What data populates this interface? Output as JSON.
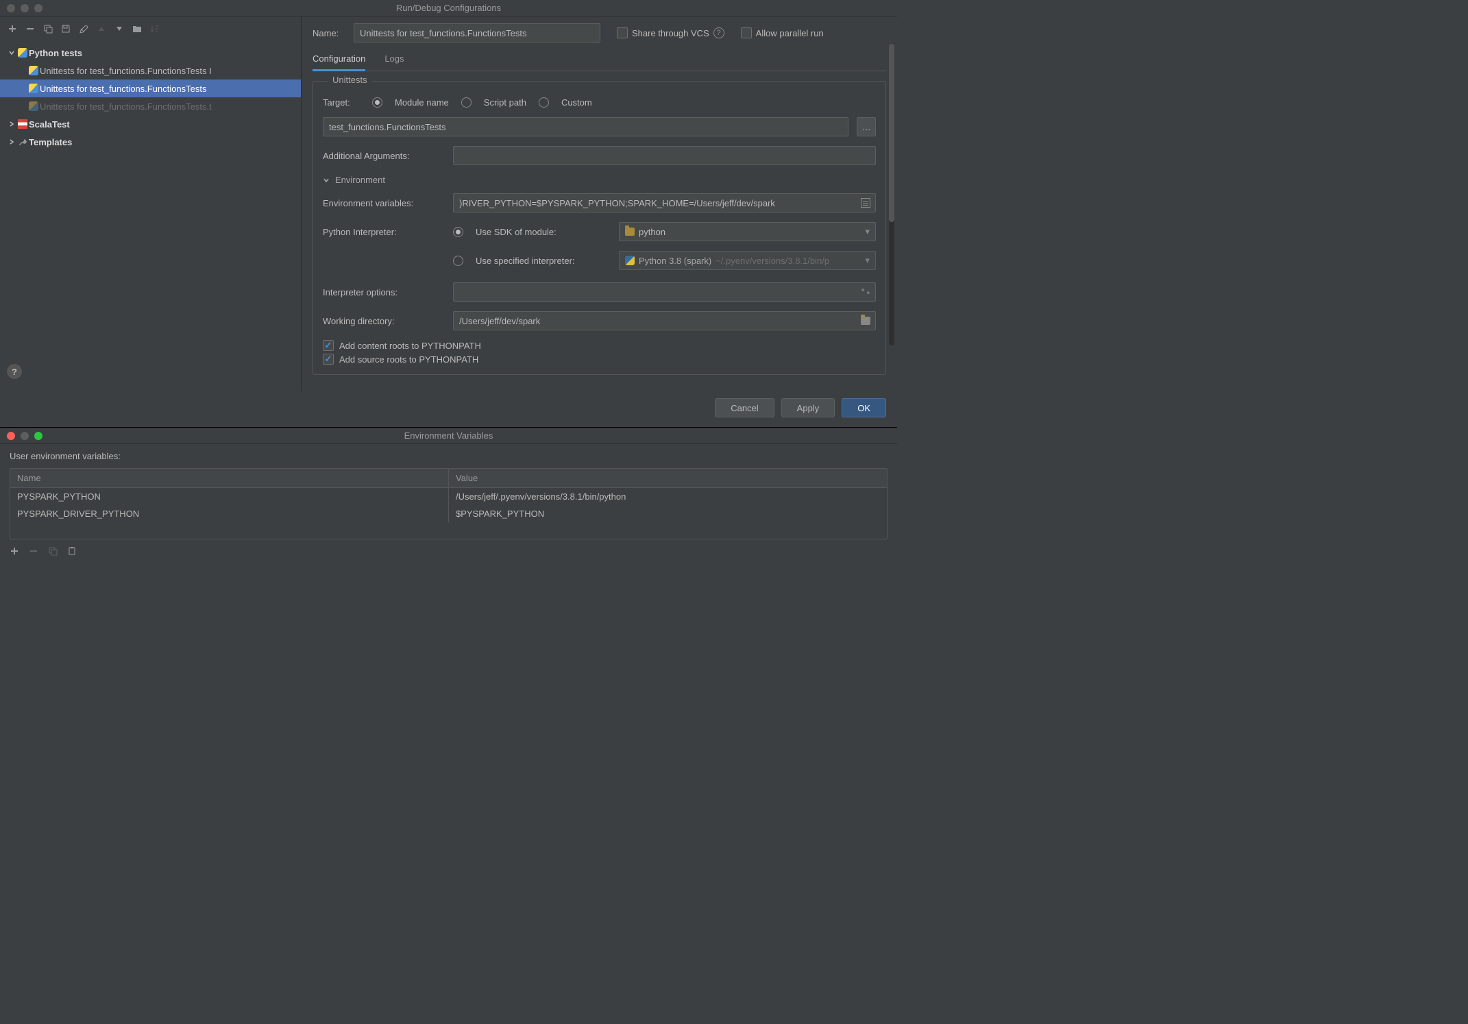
{
  "window_title": "Run/Debug Configurations",
  "name_label": "Name:",
  "name_value": "Unittests for test_functions.FunctionsTests",
  "share_vcs": "Share through VCS",
  "allow_parallel": "Allow parallel run",
  "tabs": {
    "config": "Configuration",
    "logs": "Logs"
  },
  "fieldset_title": "Unittests",
  "target_label": "Target:",
  "target_options": {
    "module": "Module name",
    "script": "Script path",
    "custom": "Custom"
  },
  "target_value": "test_functions.FunctionsTests",
  "additional_args_label": "Additional Arguments:",
  "env_section": "Environment",
  "env_vars_label": "Environment variables:",
  "env_vars_value": ")RIVER_PYTHON=$PYSPARK_PYTHON;SPARK_HOME=/Users/jeff/dev/spark",
  "py_interpreter_label": "Python Interpreter:",
  "use_sdk": "Use SDK of module:",
  "sdk_module": "python",
  "use_specified": "Use specified interpreter:",
  "specified_interpreter": "Python 3.8 (spark)",
  "specified_interpreter_path": "~/.pyenv/versions/3.8.1/bin/p",
  "interp_options_label": "Interpreter options:",
  "working_dir_label": "Working directory:",
  "working_dir_value": "/Users/jeff/dev/spark",
  "add_content_roots": "Add content roots to PYTHONPATH",
  "add_source_roots": "Add source roots to PYTHONPATH",
  "buttons": {
    "cancel": "Cancel",
    "apply": "Apply",
    "ok": "OK"
  },
  "tree": {
    "python_tests": "Python tests",
    "item1": "Unittests for test_functions.FunctionsTests I",
    "item2": "Unittests for test_functions.FunctionsTests",
    "item3": "Unittests for test_functions.FunctionsTests.t",
    "scalatest": "ScalaTest",
    "templates": "Templates"
  },
  "envvar_window": {
    "title": "Environment Variables",
    "heading": "User environment variables:",
    "col_name": "Name",
    "col_value": "Value",
    "rows": [
      {
        "name": "PYSPARK_PYTHON",
        "value": "/Users/jeff/.pyenv/versions/3.8.1/bin/python"
      },
      {
        "name": "PYSPARK_DRIVER_PYTHON",
        "value": "$PYSPARK_PYTHON"
      }
    ]
  }
}
